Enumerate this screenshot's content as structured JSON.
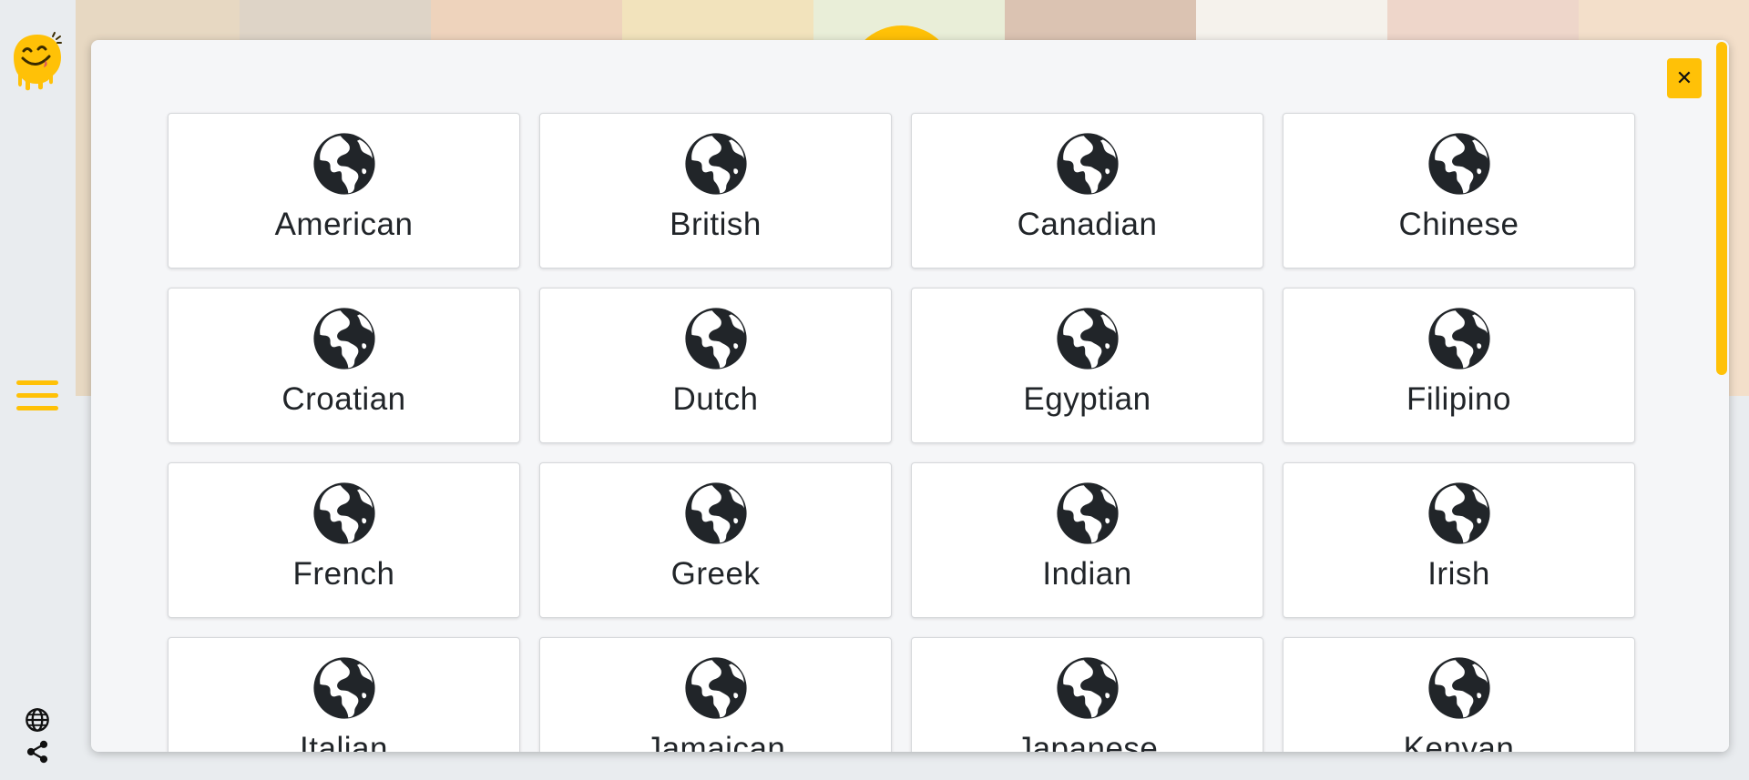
{
  "colors": {
    "accent": "#ffc107",
    "icon": "#212529",
    "card_bg": "#ffffff",
    "modal_bg": "#f5f6f8"
  },
  "sidebar": {
    "logo_icon": "yum-face-logo",
    "menu_icon": "hamburger-menu-icon",
    "language_icon": "globe-icon",
    "share_icon": "share-icon"
  },
  "modal": {
    "close_label": "✕",
    "card_icon": "globe-icon",
    "areas": [
      "American",
      "British",
      "Canadian",
      "Chinese",
      "Croatian",
      "Dutch",
      "Egyptian",
      "Filipino",
      "French",
      "Greek",
      "Indian",
      "Irish",
      "Italian",
      "Jamaican",
      "Japanese",
      "Kenyan"
    ]
  }
}
